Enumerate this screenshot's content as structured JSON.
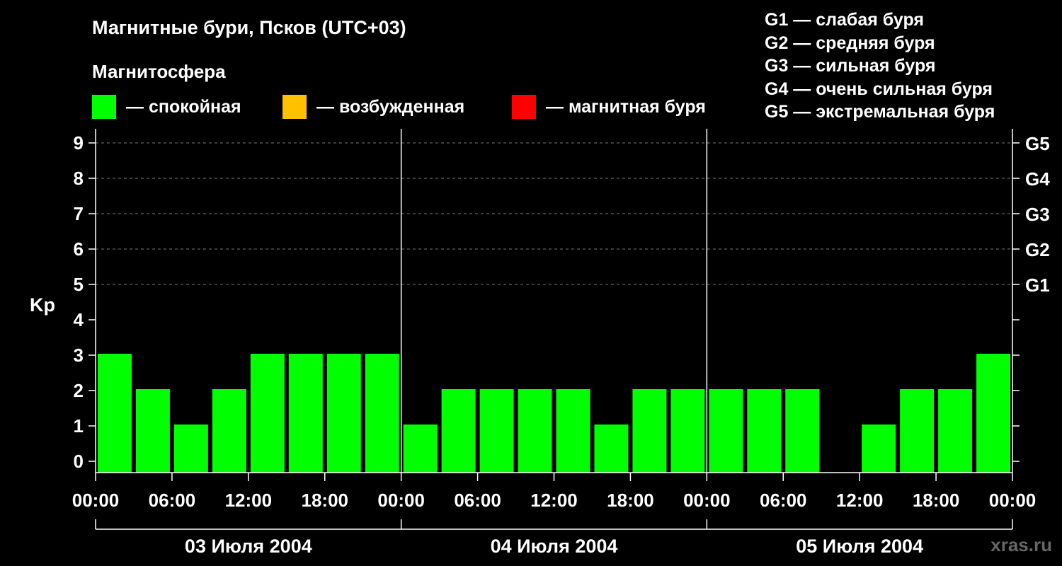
{
  "title": "Магнитные бури, Псков (UTC+03)",
  "legend": {
    "heading": "Магнитосфера",
    "items": [
      {
        "label": "— спокойная",
        "color": "#00ff00"
      },
      {
        "label": "— возбужденная",
        "color": "#ffc000"
      },
      {
        "label": "— магнитная буря",
        "color": "#ff0000"
      }
    ]
  },
  "g_scale": [
    "G1 — слабая буря",
    "G2 — средняя буря",
    "G3 — сильная буря",
    "G4 — очень сильная буря",
    "G5 — экстремальная буря"
  ],
  "watermark": "xras.ru",
  "chart_data": {
    "type": "bar",
    "ylabel": "Kp",
    "ylim": [
      0,
      9
    ],
    "yticks": [
      0,
      1,
      2,
      3,
      4,
      5,
      6,
      7,
      8,
      9
    ],
    "right_axis_labels": [
      {
        "kp": 5,
        "label": "G1"
      },
      {
        "kp": 6,
        "label": "G2"
      },
      {
        "kp": 7,
        "label": "G3"
      },
      {
        "kp": 8,
        "label": "G4"
      },
      {
        "kp": 9,
        "label": "G5"
      }
    ],
    "x_tick_labels": [
      "00:00",
      "06:00",
      "12:00",
      "18:00",
      "00:00",
      "06:00",
      "12:00",
      "18:00",
      "00:00",
      "06:00",
      "12:00",
      "18:00",
      "00:00"
    ],
    "days": [
      "03 Июля 2004",
      "04 Июля 2004",
      "05 Июля 2004"
    ],
    "interval_hours": 3,
    "bar_color": "#00ff00",
    "values": [
      3,
      2,
      1,
      2,
      3,
      3,
      3,
      3,
      1,
      2,
      2,
      2,
      2,
      1,
      2,
      2,
      2,
      2,
      2,
      0,
      1,
      2,
      2,
      3
    ],
    "grid": true
  }
}
